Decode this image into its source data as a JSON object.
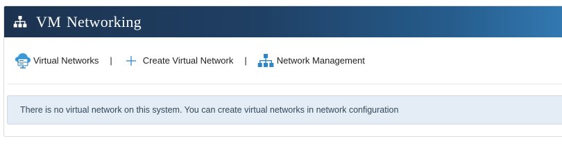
{
  "header": {
    "title": "VM  Networking",
    "icon": "network-tree-icon",
    "gradient_start": "#1c3350",
    "gradient_end": "#3278b1"
  },
  "toolbar": {
    "virtual_networks_label": "Virtual Networks",
    "virtual_networks_icon": "cloud-server-icon",
    "separator": "|",
    "create_label": "Create Virtual Network",
    "create_icon": "plus-icon",
    "management_label": "Network Management",
    "management_icon": "network-tree-icon"
  },
  "notice": {
    "message": "There is no virtual network on this system. You can create virtual networks in network configuration",
    "background": "#e4edf6"
  }
}
